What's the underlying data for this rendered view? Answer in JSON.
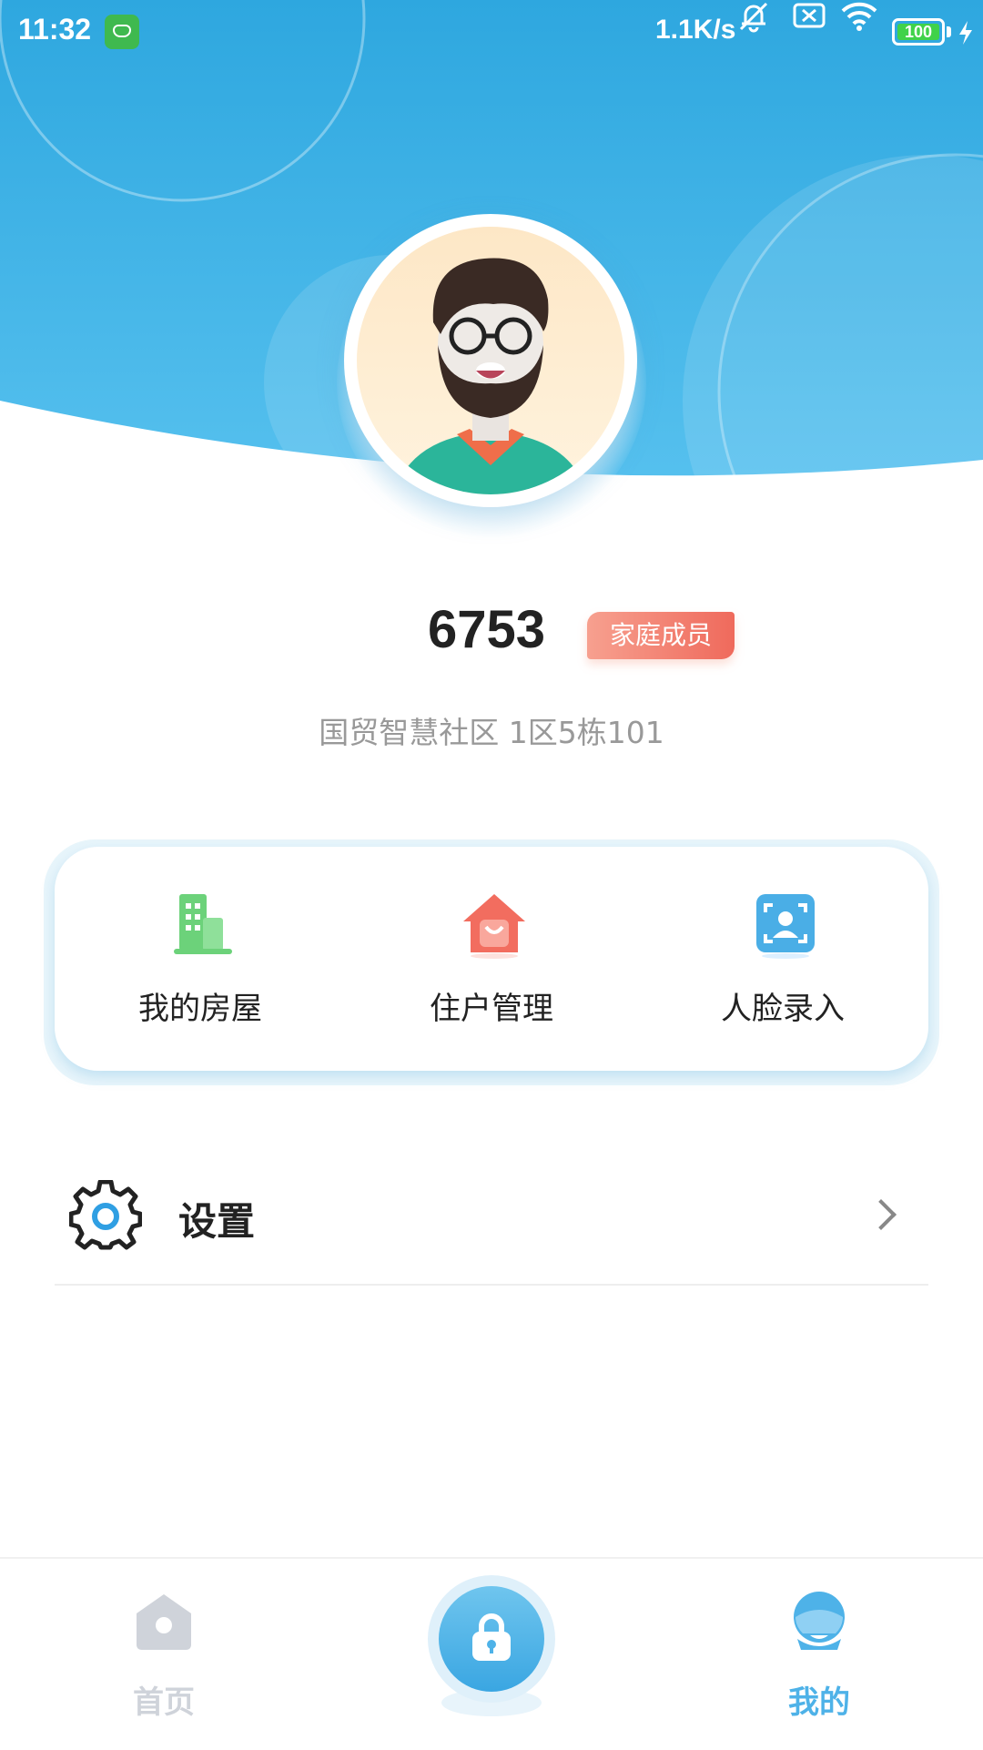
{
  "status_bar": {
    "time": "11:32",
    "network_speed": "1.1K/s",
    "battery": "100",
    "icons": [
      "app-cat-icon",
      "mute-bell-icon",
      "sim-x-icon",
      "wifi-icon",
      "battery-icon",
      "charging-bolt-icon"
    ]
  },
  "profile": {
    "name": "6753",
    "role": "家庭成员",
    "address": "国贸智慧社区  1区5栋101"
  },
  "quick_actions": [
    {
      "label": "我的房屋",
      "icon": "building-icon",
      "color": "#6cd27a"
    },
    {
      "label": "住户管理",
      "icon": "house-bag-icon",
      "color": "#f26d5f"
    },
    {
      "label": "人脸录入",
      "icon": "face-scan-icon",
      "color": "#4aaee6"
    }
  ],
  "settings": {
    "label": "设置",
    "icon": "gear-icon"
  },
  "bottom_nav": {
    "home": {
      "label": "首页",
      "icon": "home-icon",
      "color": "#cfd3da"
    },
    "center": {
      "icon": "lock-icon"
    },
    "mine": {
      "label": "我的",
      "icon": "user-icon",
      "color": "#4eb2e8",
      "active": true
    }
  },
  "colors": {
    "header_blue": "#3aaee4",
    "accent_blue": "#4eb2e8",
    "badge_red": "#ef6a5c"
  }
}
